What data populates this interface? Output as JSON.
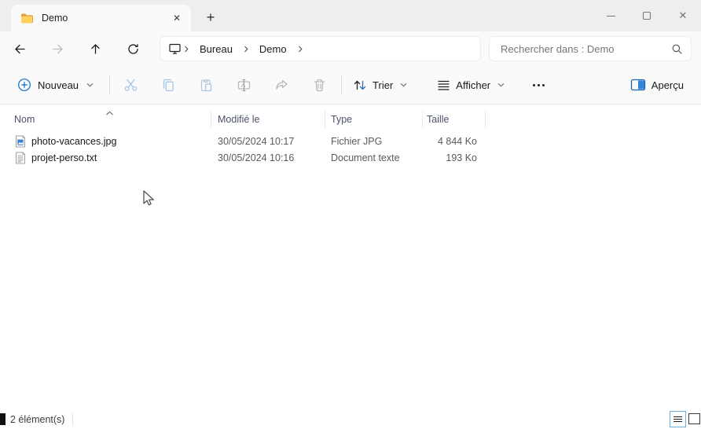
{
  "window": {
    "tab": {
      "title": "Demo"
    },
    "controls": {
      "close_glyph": "✕",
      "tab_close_glyph": "✕",
      "new_tab_glyph": "+"
    }
  },
  "navigation": {
    "breadcrumb": {
      "items": [
        "Bureau",
        "Demo"
      ]
    },
    "search": {
      "placeholder": "Rechercher dans : Demo",
      "value": ""
    }
  },
  "toolbar": {
    "new_label": "Nouveau",
    "sort_label": "Trier",
    "view_label": "Afficher",
    "preview_label": "Aperçu"
  },
  "file_list": {
    "columns": [
      "Nom",
      "Modifié le",
      "Type",
      "Taille"
    ],
    "files": [
      {
        "name": "photo-vacances.jpg",
        "modified": "30/05/2024 10:17",
        "type": "Fichier JPG",
        "size": "4 844 Ko",
        "icon": "image-file-icon"
      },
      {
        "name": "projet-perso.txt",
        "modified": "30/05/2024 10:16",
        "type": "Document texte",
        "size": "193 Ko",
        "icon": "text-file-icon"
      }
    ]
  },
  "status_bar": {
    "items_count": "2 élément(s)"
  },
  "colors": {
    "accent": "#0b6bc2",
    "folder": "#ffca45",
    "disabled_blue": "#a3c6e8",
    "disabled_gray": "#b9b9b9"
  }
}
